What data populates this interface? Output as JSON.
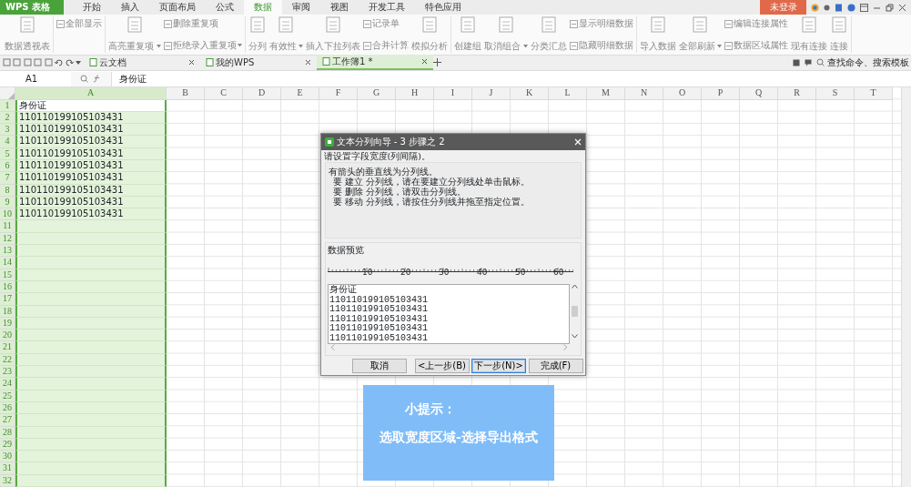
{
  "app_button": "WPS 表格",
  "menu_tabs": [
    {
      "label": "开始",
      "selected": false
    },
    {
      "label": "插入",
      "selected": false
    },
    {
      "label": "页面布局",
      "selected": false
    },
    {
      "label": "公式",
      "selected": false
    },
    {
      "label": "数据",
      "selected": true
    },
    {
      "label": "审阅",
      "selected": false
    },
    {
      "label": "视图",
      "selected": false
    },
    {
      "label": "开发工具",
      "selected": false
    },
    {
      "label": "特色应用",
      "selected": false
    }
  ],
  "account_button": "未登录",
  "ribbon_groups": [
    {
      "items": [
        {
          "kind": "large",
          "label": "数据透视表",
          "dropdown": false
        }
      ]
    },
    {
      "items": [
        {
          "kind": "small",
          "label": "全部显示",
          "dropdown": false
        }
      ]
    },
    {
      "items": [
        {
          "kind": "large",
          "label": "高亮重复项",
          "dropdown": true
        },
        {
          "kind": "small",
          "label": "删除重复项",
          "dropdown": false
        },
        {
          "kind": "small",
          "label": "拒绝录入重复项",
          "dropdown": true
        }
      ]
    },
    {
      "items": [
        {
          "kind": "large",
          "label": "分列",
          "dropdown": false
        },
        {
          "kind": "large",
          "label": "有效性",
          "dropdown": true
        },
        {
          "kind": "large",
          "label": "插入下拉列表",
          "dropdown": false
        },
        {
          "kind": "small",
          "label": "记录单",
          "dropdown": false
        },
        {
          "kind": "small",
          "label": "合并计算",
          "dropdown": false
        },
        {
          "kind": "large",
          "label": "模拟分析",
          "dropdown": false
        }
      ]
    },
    {
      "items": [
        {
          "kind": "large",
          "label": "创建组",
          "dropdown": false
        },
        {
          "kind": "large",
          "label": "取消组合",
          "dropdown": true
        },
        {
          "kind": "large",
          "label": "分类汇总",
          "dropdown": false
        },
        {
          "kind": "small",
          "label": "显示明细数据",
          "dropdown": false
        },
        {
          "kind": "small",
          "label": "隐藏明细数据",
          "dropdown": false
        }
      ]
    },
    {
      "items": [
        {
          "kind": "large",
          "label": "导入数据",
          "dropdown": false
        },
        {
          "kind": "large",
          "label": "全部刷新",
          "dropdown": true
        },
        {
          "kind": "small",
          "label": "编辑连接属性",
          "dropdown": false
        },
        {
          "kind": "small",
          "label": "数据区域属性",
          "dropdown": false
        },
        {
          "kind": "large",
          "label": "现有连接",
          "dropdown": false
        },
        {
          "kind": "large",
          "label": "连接",
          "dropdown": false
        }
      ]
    }
  ],
  "doc_tabs": [
    {
      "label": "云文档",
      "selected": false
    },
    {
      "label": "我的WPS",
      "selected": false
    },
    {
      "label": "工作簿1 *",
      "selected": true
    }
  ],
  "search_command": "查找命令、搜索模板",
  "name_box": "A1",
  "formula": "身份证",
  "columns": [
    {
      "label": "A",
      "selected": true
    },
    {
      "label": "B",
      "selected": false
    },
    {
      "label": "C",
      "selected": false
    },
    {
      "label": "D",
      "selected": false
    },
    {
      "label": "E",
      "selected": false
    },
    {
      "label": "F",
      "selected": false
    },
    {
      "label": "G",
      "selected": false
    },
    {
      "label": "H",
      "selected": false
    },
    {
      "label": "I",
      "selected": false
    },
    {
      "label": "J",
      "selected": false
    },
    {
      "label": "K",
      "selected": false
    },
    {
      "label": "L",
      "selected": false
    },
    {
      "label": "M",
      "selected": false
    },
    {
      "label": "N",
      "selected": false
    },
    {
      "label": "O",
      "selected": false
    },
    {
      "label": "P",
      "selected": false
    },
    {
      "label": "Q",
      "selected": false
    },
    {
      "label": "R",
      "selected": false
    },
    {
      "label": "S",
      "selected": false
    },
    {
      "label": "T",
      "selected": false
    }
  ],
  "rows": [
    {
      "number": "1",
      "cells": [
        "身份证"
      ]
    },
    {
      "number": "2",
      "cells": [
        "110110199105103431"
      ]
    },
    {
      "number": "3",
      "cells": [
        "110110199105103431"
      ]
    },
    {
      "number": "4",
      "cells": [
        "110110199105103431"
      ]
    },
    {
      "number": "5",
      "cells": [
        "110110199105103431"
      ]
    },
    {
      "number": "6",
      "cells": [
        "110110199105103431"
      ]
    },
    {
      "number": "7",
      "cells": [
        "110110199105103431"
      ]
    },
    {
      "number": "8",
      "cells": [
        "110110199105103431"
      ]
    },
    {
      "number": "9",
      "cells": [
        "110110199105103431"
      ]
    },
    {
      "number": "10",
      "cells": [
        "110110199105103431"
      ]
    },
    {
      "number": "11",
      "cells": []
    },
    {
      "number": "12",
      "cells": []
    },
    {
      "number": "13",
      "cells": []
    },
    {
      "number": "14",
      "cells": []
    },
    {
      "number": "15",
      "cells": []
    },
    {
      "number": "16",
      "cells": []
    },
    {
      "number": "17",
      "cells": []
    },
    {
      "number": "18",
      "cells": []
    },
    {
      "number": "19",
      "cells": []
    },
    {
      "number": "20",
      "cells": []
    },
    {
      "number": "21",
      "cells": []
    },
    {
      "number": "22",
      "cells": []
    },
    {
      "number": "23",
      "cells": []
    },
    {
      "number": "24",
      "cells": []
    },
    {
      "number": "25",
      "cells": []
    },
    {
      "number": "26",
      "cells": []
    },
    {
      "number": "27",
      "cells": []
    },
    {
      "number": "28",
      "cells": []
    },
    {
      "number": "29",
      "cells": []
    },
    {
      "number": "30",
      "cells": []
    },
    {
      "number": "31",
      "cells": []
    },
    {
      "number": "32",
      "cells": []
    }
  ],
  "dialog": {
    "title": "文本分列向导 - 3 步骤之 2",
    "instruction": "请设置字段宽度(列间隔)。",
    "info_lines": [
      "有箭头的垂直线为分列线。",
      "要 建立 分列线，请在要建立分列线处单击鼠标。",
      "要 删除 分列线，请双击分列线。",
      "要 移动 分列线，请按住分列线并拖至指定位置。"
    ],
    "preview_label": "数据预览",
    "ruler_labels": [
      "10",
      "20",
      "30",
      "40",
      "50",
      "60"
    ],
    "preview_lines": [
      "身份证",
      "110110199105103431",
      "110110199105103431",
      "110110199105103431",
      "110110199105103431",
      "110110199105103431"
    ],
    "buttons": [
      {
        "label": "取消",
        "focused": false
      },
      {
        "label": "<上一步(B)",
        "focused": false
      },
      {
        "label": "下一步(N)>",
        "focused": true
      },
      {
        "label": "完成(F)",
        "focused": false
      }
    ]
  },
  "tip": {
    "title": "小提示：",
    "text": "选取宽度区域-选择导出格式"
  }
}
